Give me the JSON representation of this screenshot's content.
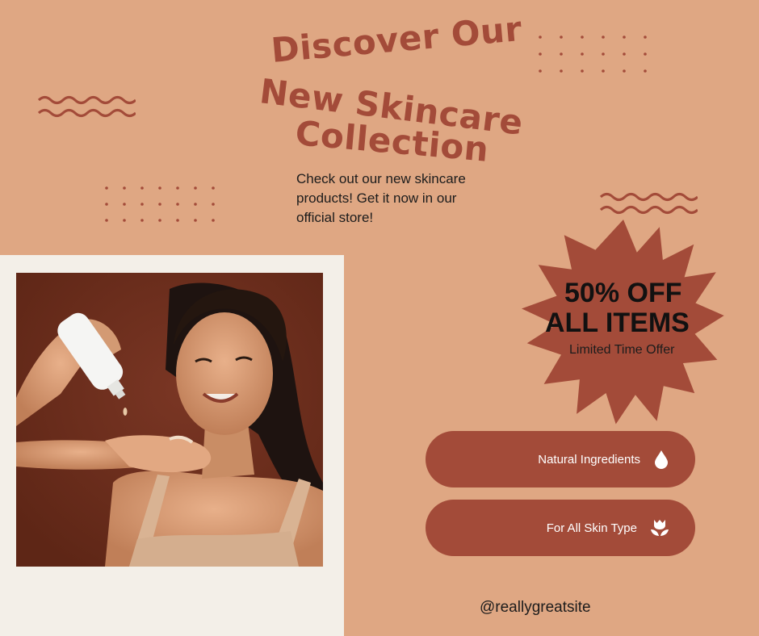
{
  "headline": {
    "line1": "Discover Our",
    "line2": "New Skincare",
    "line3": "Collection"
  },
  "subtitle": {
    "line1": "Check out our new skincare",
    "line2": "products! Get it now in our",
    "line3": "official store!"
  },
  "offer": {
    "line1": "50% OFF",
    "line2": "ALL ITEMS",
    "tagline": "Limited Time Offer"
  },
  "features": [
    {
      "label": "Natural Ingredients",
      "icon": "droplet-icon"
    },
    {
      "label": "For All Skin Type",
      "icon": "tulip-icon"
    }
  ],
  "handle": "@reallygreatsite",
  "colors": {
    "background": "#DFA783",
    "accent": "#A34B39",
    "polaroid_frame": "#F3EFE8",
    "photo_backdrop": "#6A2E1E"
  }
}
